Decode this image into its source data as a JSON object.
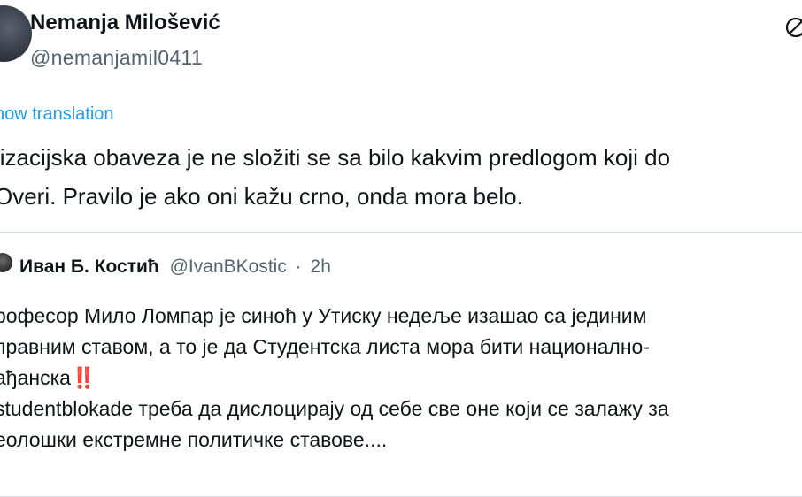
{
  "author": {
    "name": "Nemanja Milošević",
    "handle": "@nemanjamil0411"
  },
  "translation_link": "how translation",
  "tweet_lines": [
    "lizacijska obaveza je ne složiti se sa bilo kakvim predlogom koji do",
    "Overi. Pravilo je ako oni kažu crno, onda mora belo."
  ],
  "quoted": {
    "name": "Иван Б. Костић",
    "handle": "@IvanBKostic",
    "separator": "·",
    "time": "2h",
    "lines": [
      "рофесор Мило Ломпар је синоћ у Утиску недеље изашао са јединим",
      "правним ставом, а то је да Студентска листа мора бити национално-",
      "ађанска",
      "studentblokade треба да дислоцирају од себе све оне који се залажу за",
      "еолошки екстремне политичке ставове...."
    ],
    "emoji": "‼️"
  },
  "icons": {
    "top_right": "grok-icon"
  },
  "colors": {
    "link": "#1d9bf0",
    "secondary": "#536471",
    "border": "#cfd9de"
  }
}
